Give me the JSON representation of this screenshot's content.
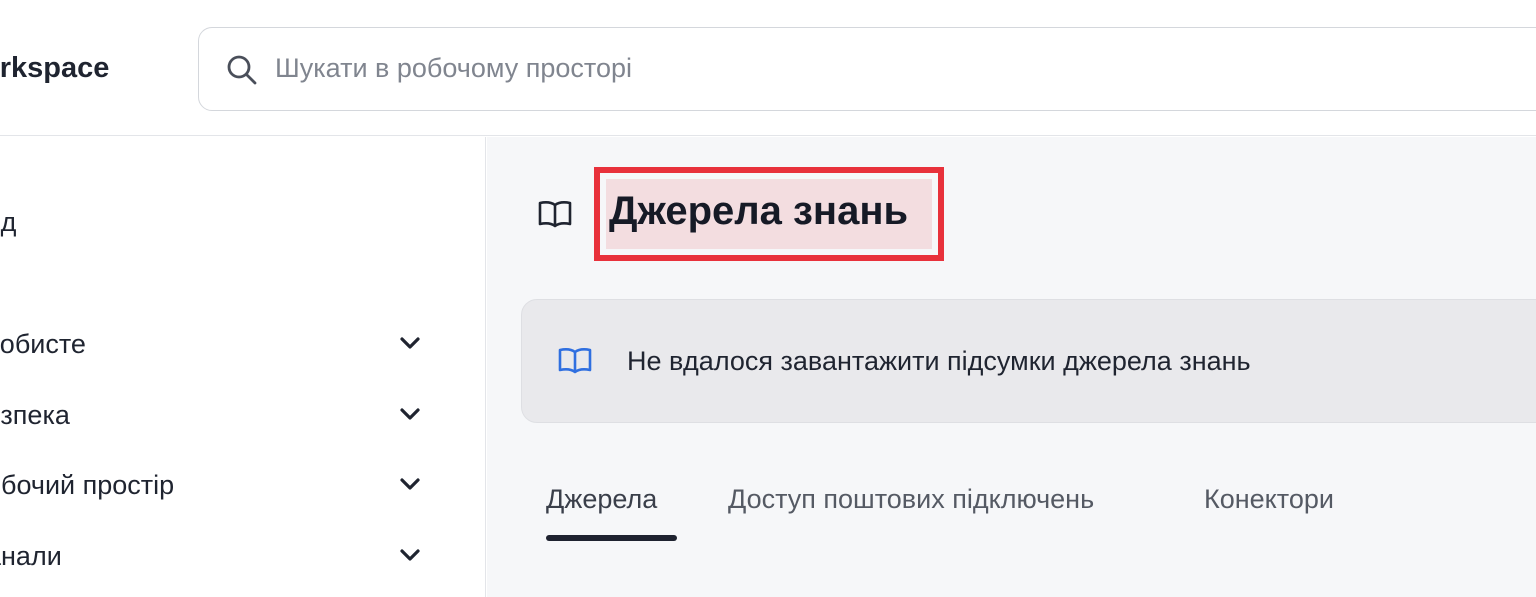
{
  "header": {
    "workspace_name": "orkspace",
    "search": {
      "placeholder": "Шукати в робочому просторі",
      "value": ""
    }
  },
  "sidebar": {
    "items": [
      {
        "label": "яд",
        "expandable": false
      },
      {
        "label": "собисте",
        "expandable": true
      },
      {
        "label": "езпека",
        "expandable": true
      },
      {
        "label": "обочий простір",
        "expandable": true
      },
      {
        "label": "анали",
        "expandable": true
      }
    ]
  },
  "main": {
    "title": "Джерела знань",
    "alert": {
      "message": "Не вдалося завантажити підсумки джерела знань"
    },
    "tabs": [
      {
        "label": "Джерела",
        "active": true
      },
      {
        "label": "Доступ поштових підключень",
        "active": false
      },
      {
        "label": "Конектори",
        "active": false
      }
    ]
  },
  "colors": {
    "highlight_border": "#e8313b",
    "alert_icon": "#2f6fe0",
    "tab_underline": "#1e2230"
  },
  "icons": {
    "search": "search-icon",
    "title": "book-open-icon",
    "alert": "book-open-icon",
    "expand": "chevron-down-icon"
  }
}
